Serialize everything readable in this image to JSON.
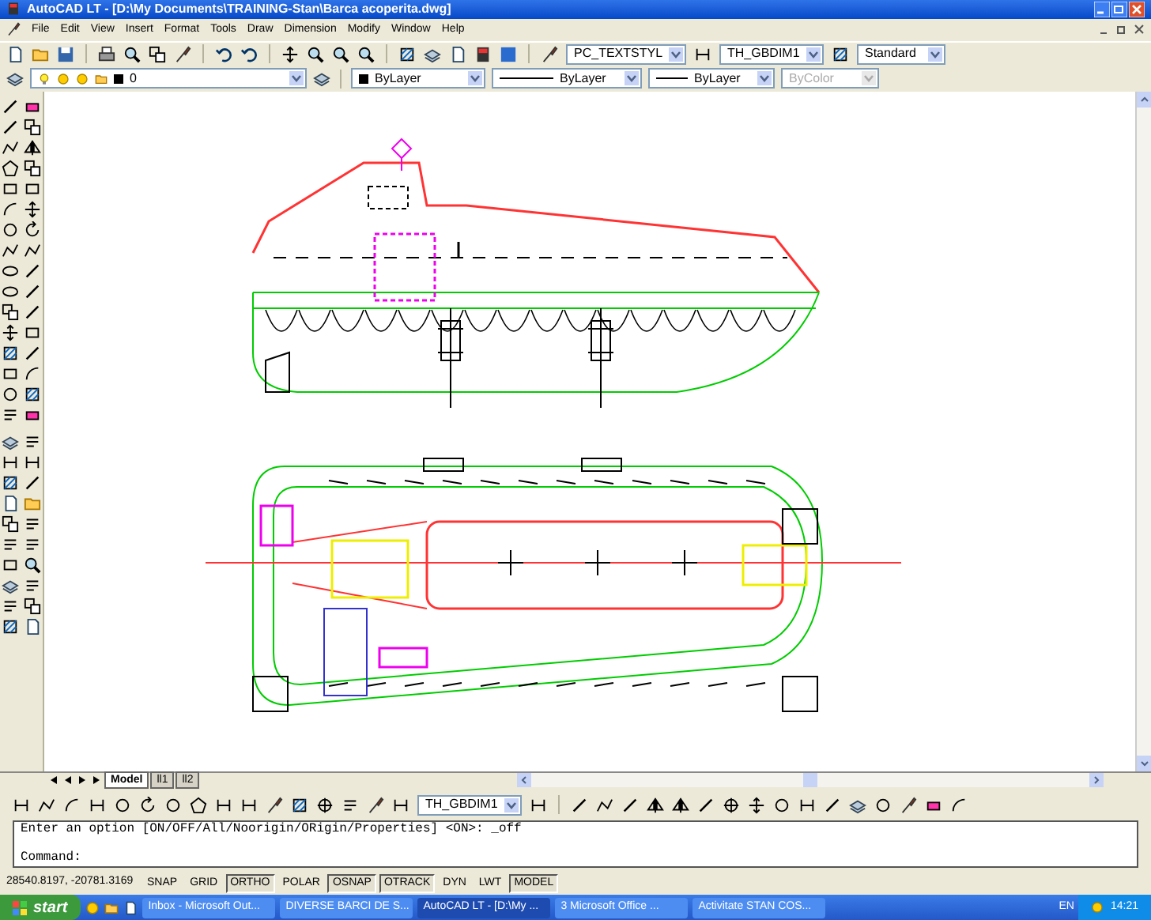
{
  "window": {
    "title": "AutoCAD LT - [D:\\My Documents\\TRAINING-Stan\\Barca acoperita.dwg]"
  },
  "menu": [
    "File",
    "Edit",
    "View",
    "Insert",
    "Format",
    "Tools",
    "Draw",
    "Dimension",
    "Modify",
    "Window",
    "Help"
  ],
  "styles_toolbar": {
    "text_style": "PC_TEXTSTYL",
    "dim_style": "TH_GBDIM1",
    "table_style": "Standard"
  },
  "properties_toolbar": {
    "layer": "0",
    "object_color": "ByLayer",
    "linetype": "ByLayer",
    "lineweight": "ByLayer",
    "plot_style": {
      "value": "ByColor",
      "disabled": true
    }
  },
  "layout_tabs": [
    {
      "label": "Model",
      "selected": true
    },
    {
      "label": "ll1",
      "selected": false
    },
    {
      "label": "ll2",
      "selected": false
    }
  ],
  "dimension_toolbar": {
    "dim_style": "TH_GBDIM1"
  },
  "command_window": {
    "history": "Enter an option [ON/OFF/All/Noorigin/ORigin/Properties] <ON>: _off",
    "prompt": "Command:"
  },
  "status_bar": {
    "coordinates": "28540.8197, -20781.3169",
    "toggles": [
      {
        "label": "SNAP",
        "on": false
      },
      {
        "label": "GRID",
        "on": false
      },
      {
        "label": "ORTHO",
        "on": true
      },
      {
        "label": "POLAR",
        "on": false
      },
      {
        "label": "OSNAP",
        "on": true
      },
      {
        "label": "OTRACK",
        "on": true
      },
      {
        "label": "DYN",
        "on": false
      },
      {
        "label": "LWT",
        "on": false
      },
      {
        "label": "MODEL",
        "on": true
      }
    ]
  },
  "taskbar": {
    "start": "start",
    "tasks": [
      {
        "label": "Inbox - Microsoft Out...",
        "selected": false
      },
      {
        "label": "DIVERSE BARCI DE S...",
        "selected": false
      },
      {
        "label": "AutoCAD LT - [D:\\My ...",
        "selected": true
      },
      {
        "label": "3 Microsoft Office ...",
        "selected": false
      },
      {
        "label": "Activitate STAN COS...",
        "selected": false
      }
    ],
    "language": "EN",
    "clock": "14:21"
  }
}
